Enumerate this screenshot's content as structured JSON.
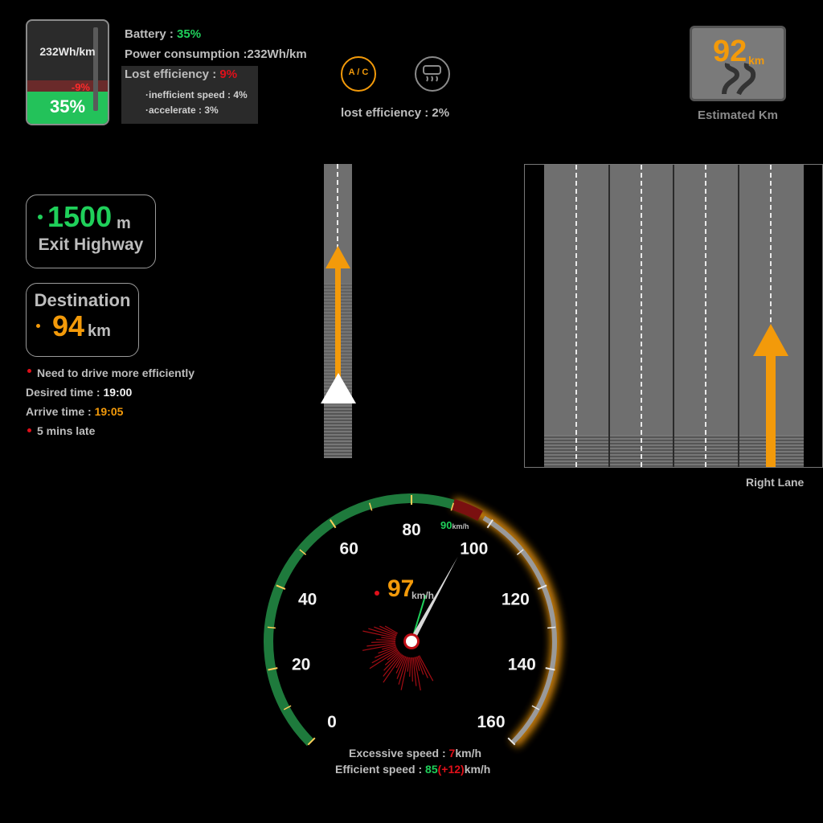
{
  "battery": {
    "ratio": "232Wh/km",
    "loss": "-9%",
    "percent": "35%",
    "level": 0.35,
    "battery_label": "Battery : ",
    "battery_value": "35%",
    "consumption": "Power consumption :232Wh/km",
    "lost_label": "Lost efficiency : ",
    "lost_value": "9%",
    "inefficient_speed": "·inefficient speed : 4%",
    "accelerate": "·accelerate : 3%"
  },
  "climate": {
    "ac_label": "A / C",
    "ac_icon": "ac-icon",
    "defrost_icon": "rear-defrost-icon",
    "lost_efficiency": "lost efficiency : 2%"
  },
  "estimate": {
    "value": "92",
    "unit": "km",
    "label": "Estimated Km",
    "icon": "road-icon"
  },
  "exit": {
    "distance": "1500",
    "unit": "m",
    "label": "Exit Highway"
  },
  "destination": {
    "title": "Destination",
    "distance": "94",
    "unit": "km"
  },
  "trip": {
    "warning": "Need to drive more efficiently",
    "desired_label": "Desired time : ",
    "desired_value": "19:00",
    "arrive_label": "Arrive time : ",
    "arrive_value": "19:05",
    "late": "5 mins late"
  },
  "lanes": {
    "count": 4,
    "active_lane": 4,
    "label": "Right Lane"
  },
  "speedometer": {
    "ticks": [
      "0",
      "20",
      "40",
      "60",
      "80",
      "100",
      "120",
      "140",
      "160"
    ],
    "max": 160,
    "speed": "97",
    "speed_value": 97,
    "speed_unit": "km/h",
    "efficient_speed": 90,
    "limit_label": "90",
    "limit_unit": "km/h",
    "excess_label": "Excessive speed : ",
    "excess_value": "7",
    "excess_unit": "km/h",
    "efficient_label": "Efficient speed : ",
    "efficient_value": "85",
    "efficient_delta": "(+12)",
    "efficient_unit": "km/h"
  },
  "colors": {
    "green": "#1fd05a",
    "red": "#e0101a",
    "orange": "#f39a0a"
  }
}
